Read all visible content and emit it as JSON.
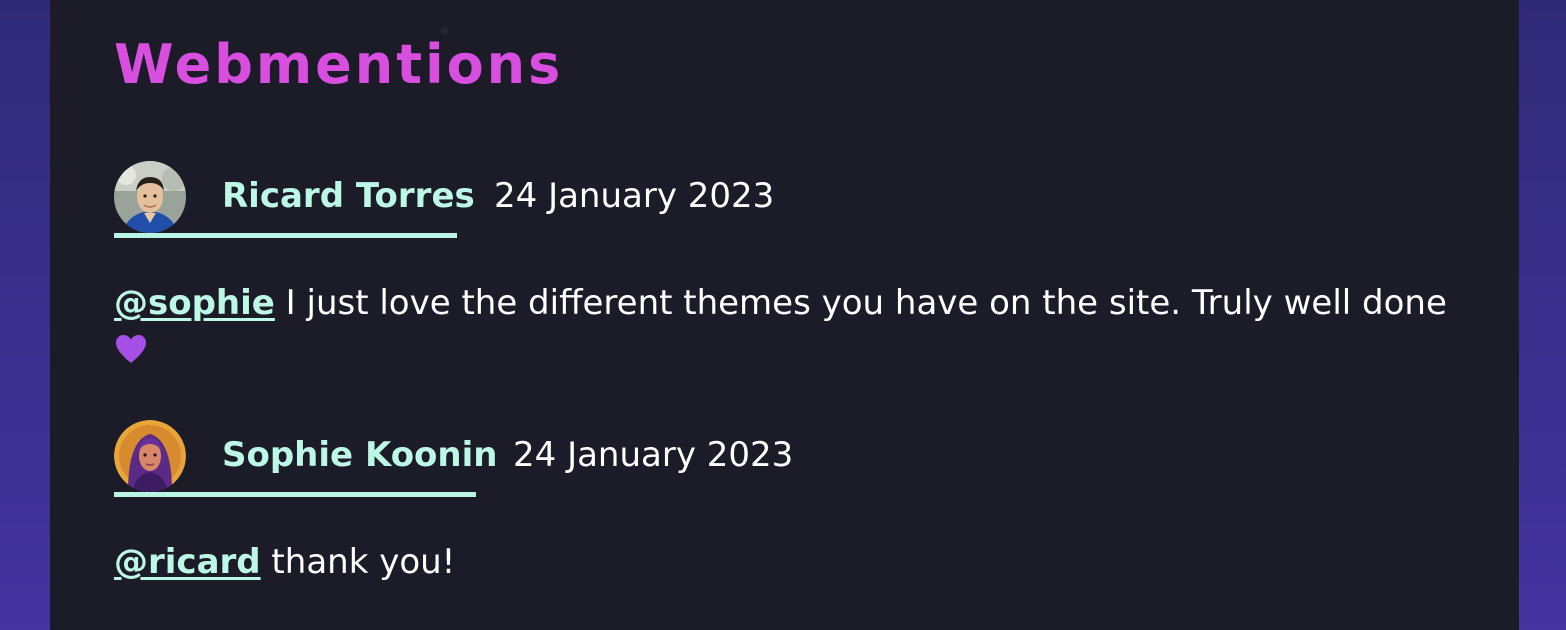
{
  "section": {
    "heading": "Webmentions"
  },
  "mentions": [
    {
      "author": "Ricard Torres",
      "date": "24 January 2023",
      "handle": "@sophie",
      "text": " I just love the different themes you have on the site. Truly well done ",
      "emoji": "purple-heart"
    },
    {
      "author": "Sophie Koonin",
      "date": "24 January 2023",
      "handle": "@ricard",
      "text": " thank you!"
    }
  ],
  "colors": {
    "heading": "#d84fe0",
    "accent": "#bdf7e5",
    "panel_bg": "#1c1b28",
    "page_bg": "#3a2f8f",
    "heart": "#a64fe6"
  }
}
